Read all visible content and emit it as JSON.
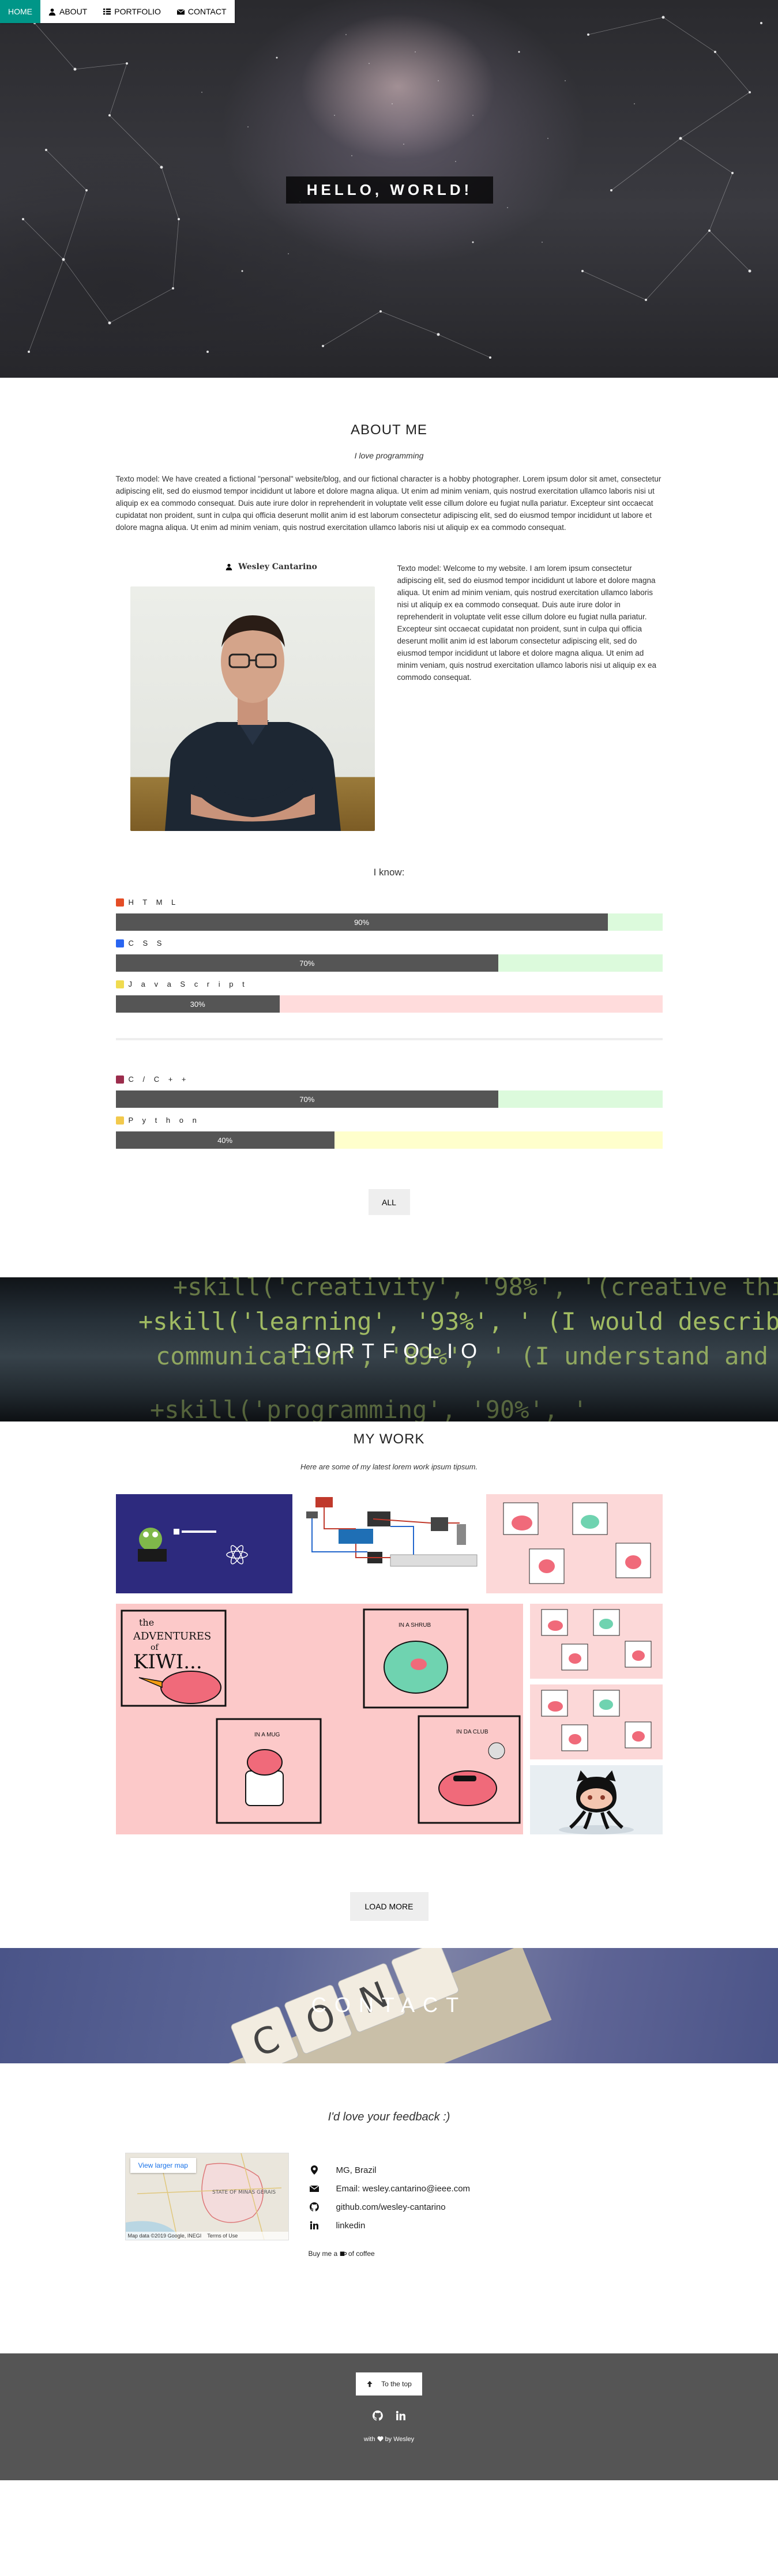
{
  "nav": [
    {
      "label": "HOME",
      "icon": "none",
      "active": true
    },
    {
      "label": "ABOUT",
      "icon": "user-icon",
      "active": false
    },
    {
      "label": "PORTFOLIO",
      "icon": "grid-icon",
      "active": false
    },
    {
      "label": "CONTACT",
      "icon": "envelope-icon",
      "active": false
    }
  ],
  "hero": {
    "title": "HELLO, WORLD!"
  },
  "about": {
    "title": "ABOUT ME",
    "subtitle": "I love programming",
    "intro": "Texto model: We have created a fictional \"personal\" website/blog, and our fictional character is a hobby photographer. Lorem ipsum dolor sit amet, consectetur adipiscing elit, sed do eiusmod tempor incididunt ut labore et dolore magna aliqua. Ut enim ad minim veniam, quis nostrud exercitation ullamco laboris nisi ut aliquip ex ea commodo consequat. Duis aute irure dolor in reprehenderit in voluptate velit esse cillum dolore eu fugiat nulla pariatur. Excepteur sint occaecat cupidatat non proident, sunt in culpa qui officia deserunt mollit anim id est laborum consectetur adipiscing elit, sed do eiusmod tempor incididunt ut labore et dolore magna aliqua. Ut enim ad minim veniam, quis nostrud exercitation ullamco laboris nisi ut aliquip ex ea commodo consequat.",
    "person_name": "Wesley Cantarino",
    "side_text": "Texto model: Welcome to my website. I am lorem ipsum consectetur adipiscing elit, sed do eiusmod tempor incididunt ut labore et dolore magna aliqua. Ut enim ad minim veniam, quis nostrud exercitation ullamco laboris nisi ut aliquip ex ea commodo consequat. Duis aute irure dolor in reprehenderit in voluptate velit esse cillum dolore eu fugiat nulla pariatur. Excepteur sint occaecat cupidatat non proident, sunt in culpa qui officia deserunt mollit anim id est laborum consectetur adipiscing elit, sed do eiusmod tempor incididunt ut labore et dolore magna aliqua. Ut enim ad minim veniam, quis nostrud exercitation ullamco laboris nisi ut aliquip ex ea commodo consequat.",
    "skills_heading": "I know:",
    "skills_group1": [
      {
        "name": "H T M L",
        "percent": 90,
        "label": "90%",
        "icon": "html5-icon",
        "icon_color": "#e44d26",
        "track_color": "#dcfadc"
      },
      {
        "name": "C S S",
        "percent": 70,
        "label": "70%",
        "icon": "css3-icon",
        "icon_color": "#2965f1",
        "track_color": "#dcfadc"
      },
      {
        "name": "J a v a S c r i p t",
        "percent": 30,
        "label": "30%",
        "icon": "javascript-icon",
        "icon_color": "#f0db4f",
        "track_color": "#ffdcdc"
      }
    ],
    "skills_group2": [
      {
        "name": "C / C + +",
        "percent": 70,
        "label": "70%",
        "icon": "cpp-icon",
        "icon_color": "#9b2c4c",
        "track_color": "#dcfadc"
      },
      {
        "name": "P y t h o n",
        "percent": 40,
        "label": "40%",
        "icon": "python-icon",
        "icon_color": "#f2c94c",
        "track_color": "#ffffcc"
      }
    ],
    "all_button": "ALL"
  },
  "portfolio_banner": {
    "title": "PORTFOLIO"
  },
  "work": {
    "title": "MY WORK",
    "subtitle": "Here are some of my latest lorem work ipsum tipsum.",
    "comic_title_1": "the",
    "comic_title_2": "ADVENTURES",
    "comic_title_3": "of",
    "comic_title_4": "KIWI...",
    "panel_labels": [
      "IN A SHRUB",
      "IN A MUG",
      "IN DA CLUB"
    ],
    "load_more": "LOAD MORE"
  },
  "contact_banner": {
    "title": "CONTACT"
  },
  "contact": {
    "subtitle": "I'd love your feedback :)",
    "map_button": "View larger map",
    "map_footer": [
      "Map data ©2019 Google, INEGI",
      "Terms of Use"
    ],
    "map_label": "STATE OF MINAS GERAIS",
    "items": [
      {
        "icon": "map-marker-icon",
        "text": "MG, Brazil"
      },
      {
        "icon": "envelope-icon",
        "text": "Email: wesley.cantarino@ieee.com"
      },
      {
        "icon": "github-icon",
        "text": "github.com/wesley-cantarino"
      },
      {
        "icon": "linkedin-icon",
        "text": "linkedin"
      }
    ],
    "coffee_prefix": "Buy me a",
    "coffee_suffix": "of coffee"
  },
  "footer": {
    "top_button": "To the top",
    "made_with": "with",
    "made_by": "by Wesley"
  },
  "colors": {
    "accent": "#009688",
    "bar": "#555555",
    "footer": "#555555"
  }
}
